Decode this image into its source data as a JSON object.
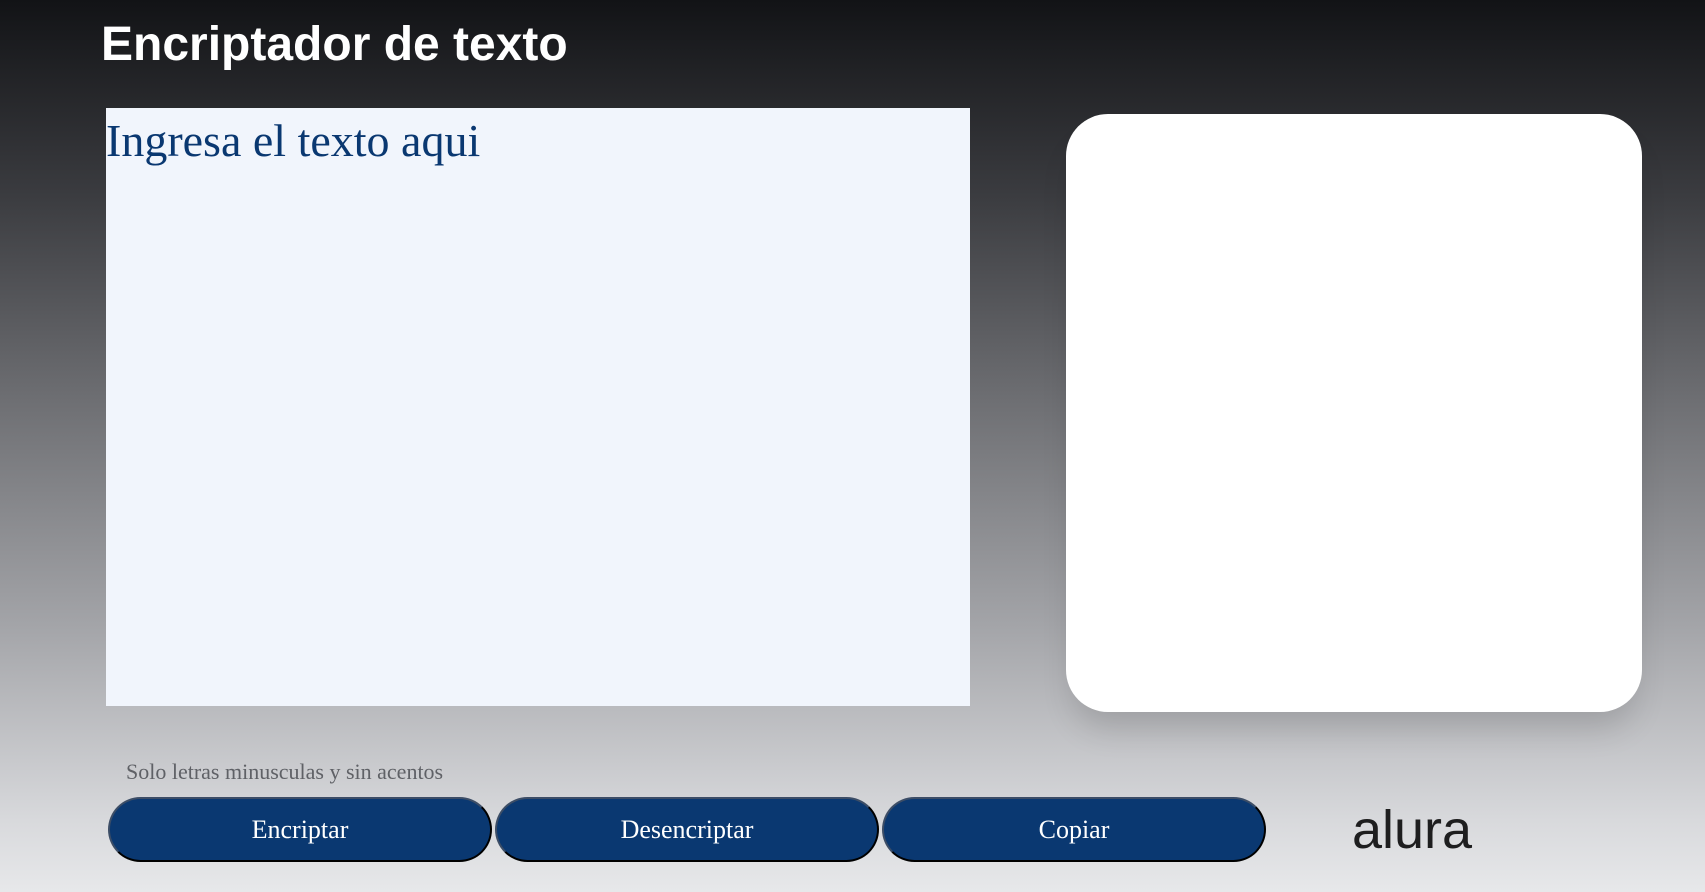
{
  "header": {
    "title": "Encriptador de texto"
  },
  "input": {
    "placeholder": "Ingresa el texto aqui",
    "value": ""
  },
  "hint": {
    "text": "Solo letras minusculas y sin acentos"
  },
  "buttons": {
    "encrypt_label": "Encriptar",
    "decrypt_label": "Desencriptar",
    "copy_label": "Copiar"
  },
  "logo": {
    "text": "alura",
    "icon": "alura-logo"
  },
  "colors": {
    "accent": "#0a3871",
    "input_bg": "#f1f5fc",
    "panel_bg": "#ffffff",
    "title": "#ffffff",
    "hint": "#5f6166",
    "logo": "#1e1e1f"
  }
}
